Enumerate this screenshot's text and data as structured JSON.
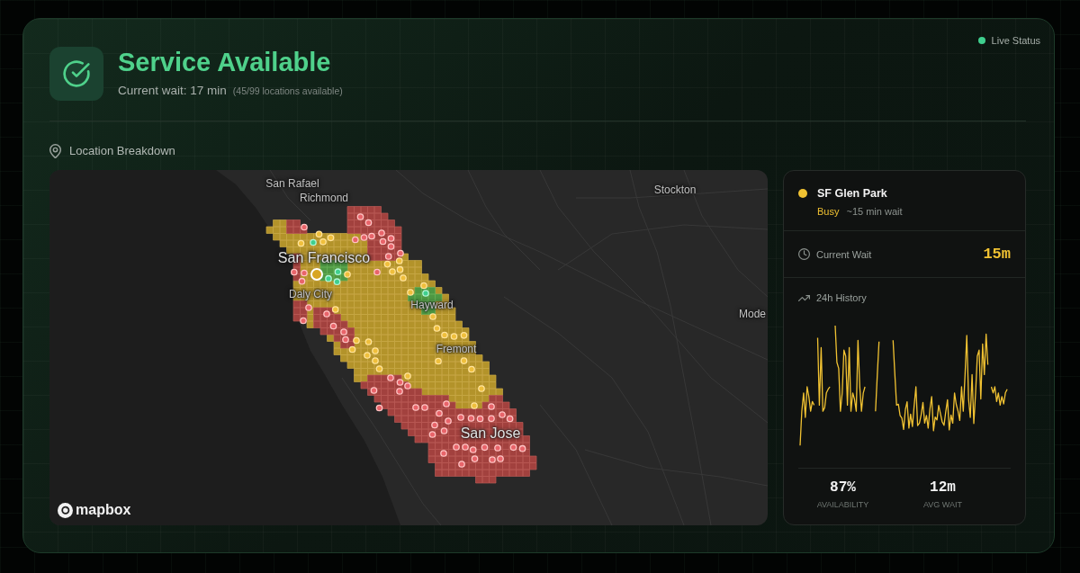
{
  "header": {
    "available": true,
    "title": "Service Available",
    "wait": "Current wait: 17 min",
    "locations": "(45/99 locations available)"
  },
  "live_status": {
    "label": "Live Status",
    "on": true
  },
  "section": {
    "title": "Location Breakdown"
  },
  "map": {
    "places": [
      {
        "name": "San Rafael",
        "kind": "minor"
      },
      {
        "name": "Richmond",
        "kind": "minor"
      },
      {
        "name": "Stockton",
        "kind": "minor"
      },
      {
        "name": "San Francisco",
        "kind": "major"
      },
      {
        "name": "Daly City",
        "kind": "minor"
      },
      {
        "name": "Hayward",
        "kind": "minor"
      },
      {
        "name": "Fremont",
        "kind": "minor"
      },
      {
        "name": "San Jose",
        "kind": "major"
      },
      {
        "name": "Mode",
        "kind": "minor"
      }
    ],
    "attribution": "mapbox"
  },
  "location": {
    "kind": "busy",
    "name": "SF Glen Park",
    "status": "Busy",
    "wait_note": "~15 min wait",
    "current_wait": {
      "label": "Current Wait",
      "value": "15m"
    },
    "history": {
      "label": "24h History"
    },
    "stats": [
      {
        "value": "87%",
        "label": "AVAILABILITY"
      },
      {
        "value": "12m",
        "label": "AVG WAIT"
      }
    ]
  }
}
